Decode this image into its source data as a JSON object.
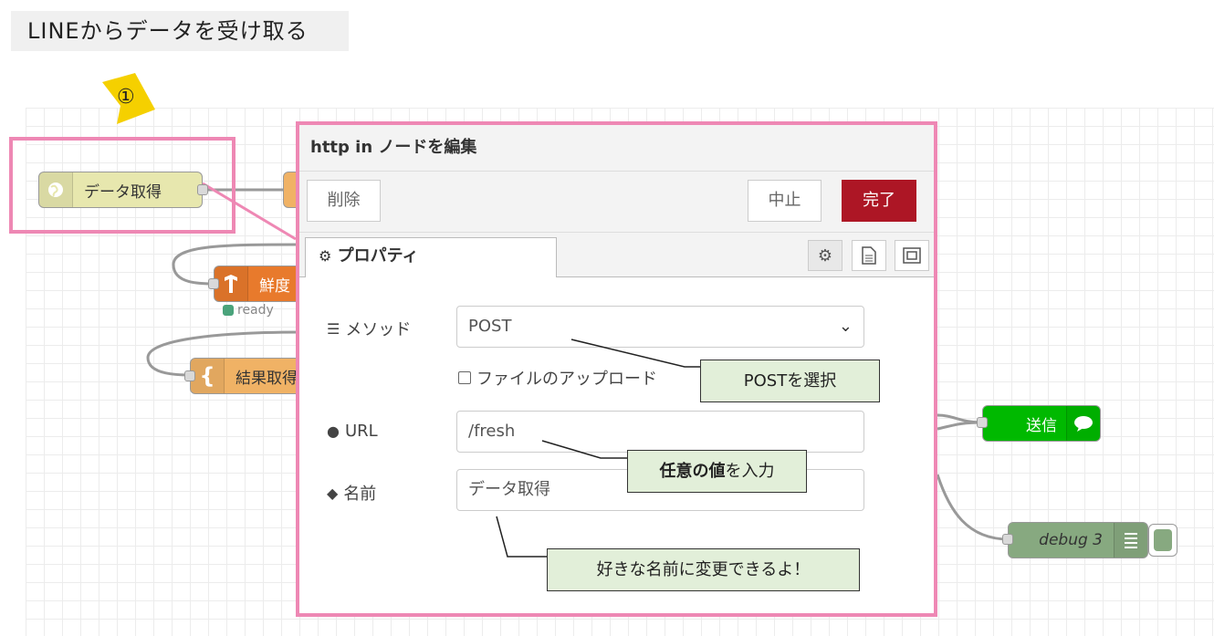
{
  "page": {
    "title": "LINEからデータを受け取る",
    "callout_number": "①"
  },
  "flow": {
    "nodes": {
      "data_fetch": "データ取得",
      "freshness": "鮮度",
      "result_fetch": "結果取得",
      "send": "送信",
      "debug": "debug 3"
    },
    "status_ready": "ready"
  },
  "dialog": {
    "title": "http in ノードを編集",
    "delete_label": "削除",
    "cancel_label": "中止",
    "done_label": "完了",
    "tab_properties": "プロパティ",
    "method_label": "メソッド",
    "method_value": "POST",
    "upload_label": "ファイルのアップロード",
    "url_label": "URL",
    "url_value": "/fresh",
    "name_label": "名前",
    "name_value": "データ取得"
  },
  "annotations": {
    "post_note": "POSTを選択",
    "url_note_bold": "任意の値",
    "url_note_rest": "を入力",
    "name_note": "好きな名前に変更できるよ！"
  },
  "colors": {
    "highlight_border": "#ee88b4",
    "done_button": "#ad1625",
    "note_background": "#e2efd9",
    "http_node": "#e7e7ae",
    "tensorflow_node": "#e87a2c",
    "template_node": "#f0b265",
    "line_node": "#00b900",
    "debug_node": "#87a980"
  }
}
